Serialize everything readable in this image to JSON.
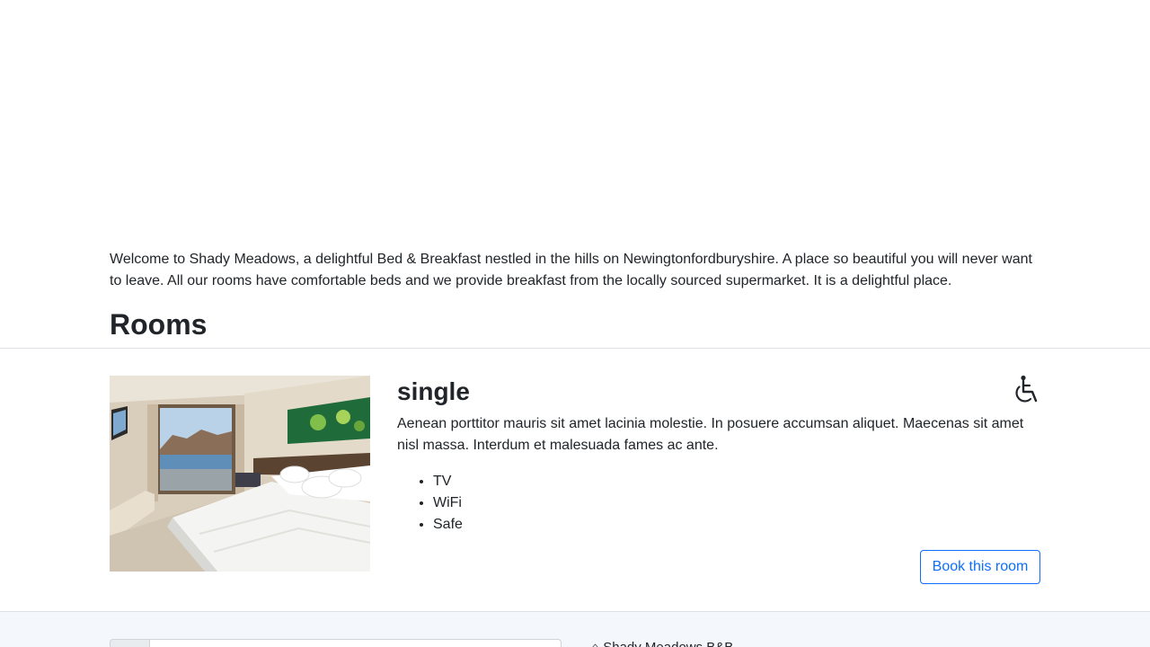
{
  "intro": {
    "text": "Welcome to Shady Meadows, a delightful Bed & Breakfast nestled in the hills on Newingtonfordburyshire. A place so beautiful you will never want to leave. All our rooms have comfortable beds and we provide breakfast from the locally sourced supermarket. It is a delightful place."
  },
  "rooms": {
    "heading": "Rooms",
    "items": [
      {
        "name": "single",
        "description": "Aenean porttitor mauris sit amet lacinia molestie. In posuere accumsan aliquet. Maecenas sit amet nisl massa. Interdum et malesuada fames ac ante.",
        "features": [
          "TV",
          "WiFi",
          "Safe"
        ],
        "accessible_icon": "wheelchair-icon",
        "book_label": "Book this room"
      }
    ]
  },
  "footer": {
    "brand": "⌂ Shady Meadows B&B"
  },
  "colors": {
    "primary": "#0d6efd",
    "text": "#212529",
    "footer_bg": "#f4f7fb",
    "divider": "#dee2e6"
  }
}
